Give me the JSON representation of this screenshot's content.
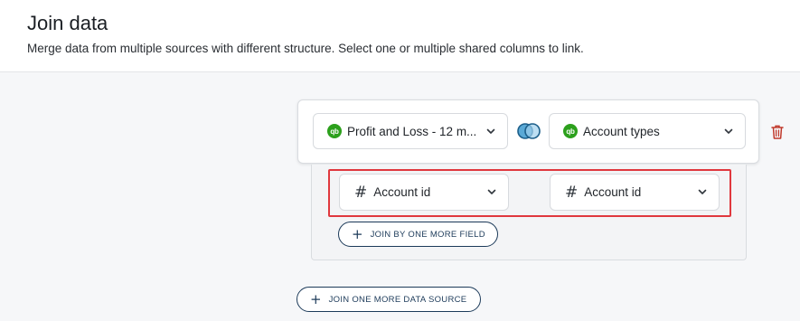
{
  "header": {
    "title": "Join data",
    "subtitle": "Merge data from multiple sources with different structure. Select one or multiple shared columns to link."
  },
  "sources": {
    "left": {
      "label": "Profit and Loss - 12 m...",
      "icon": "quickbooks-icon",
      "icon_text": "qb"
    },
    "join_type_icon": "venn-join-icon",
    "right": {
      "label": "Account types",
      "icon": "quickbooks-icon",
      "icon_text": "qb"
    },
    "delete_icon": "trash-icon"
  },
  "join_fields": {
    "left": {
      "label": "Account id",
      "icon_text": "#"
    },
    "right": {
      "label": "Account id",
      "icon_text": "#"
    },
    "add_field_button": {
      "icon_text": "+",
      "label": "JOIN BY ONE MORE FIELD"
    }
  },
  "add_source_button": {
    "icon_text": "+",
    "label": "JOIN ONE MORE DATA SOURCE"
  },
  "colors": {
    "quickbooks_green": "#2ca01c",
    "accent_navy": "#1d3b5a",
    "highlight_red": "#e0383e",
    "delete_red": "#c0392b"
  }
}
